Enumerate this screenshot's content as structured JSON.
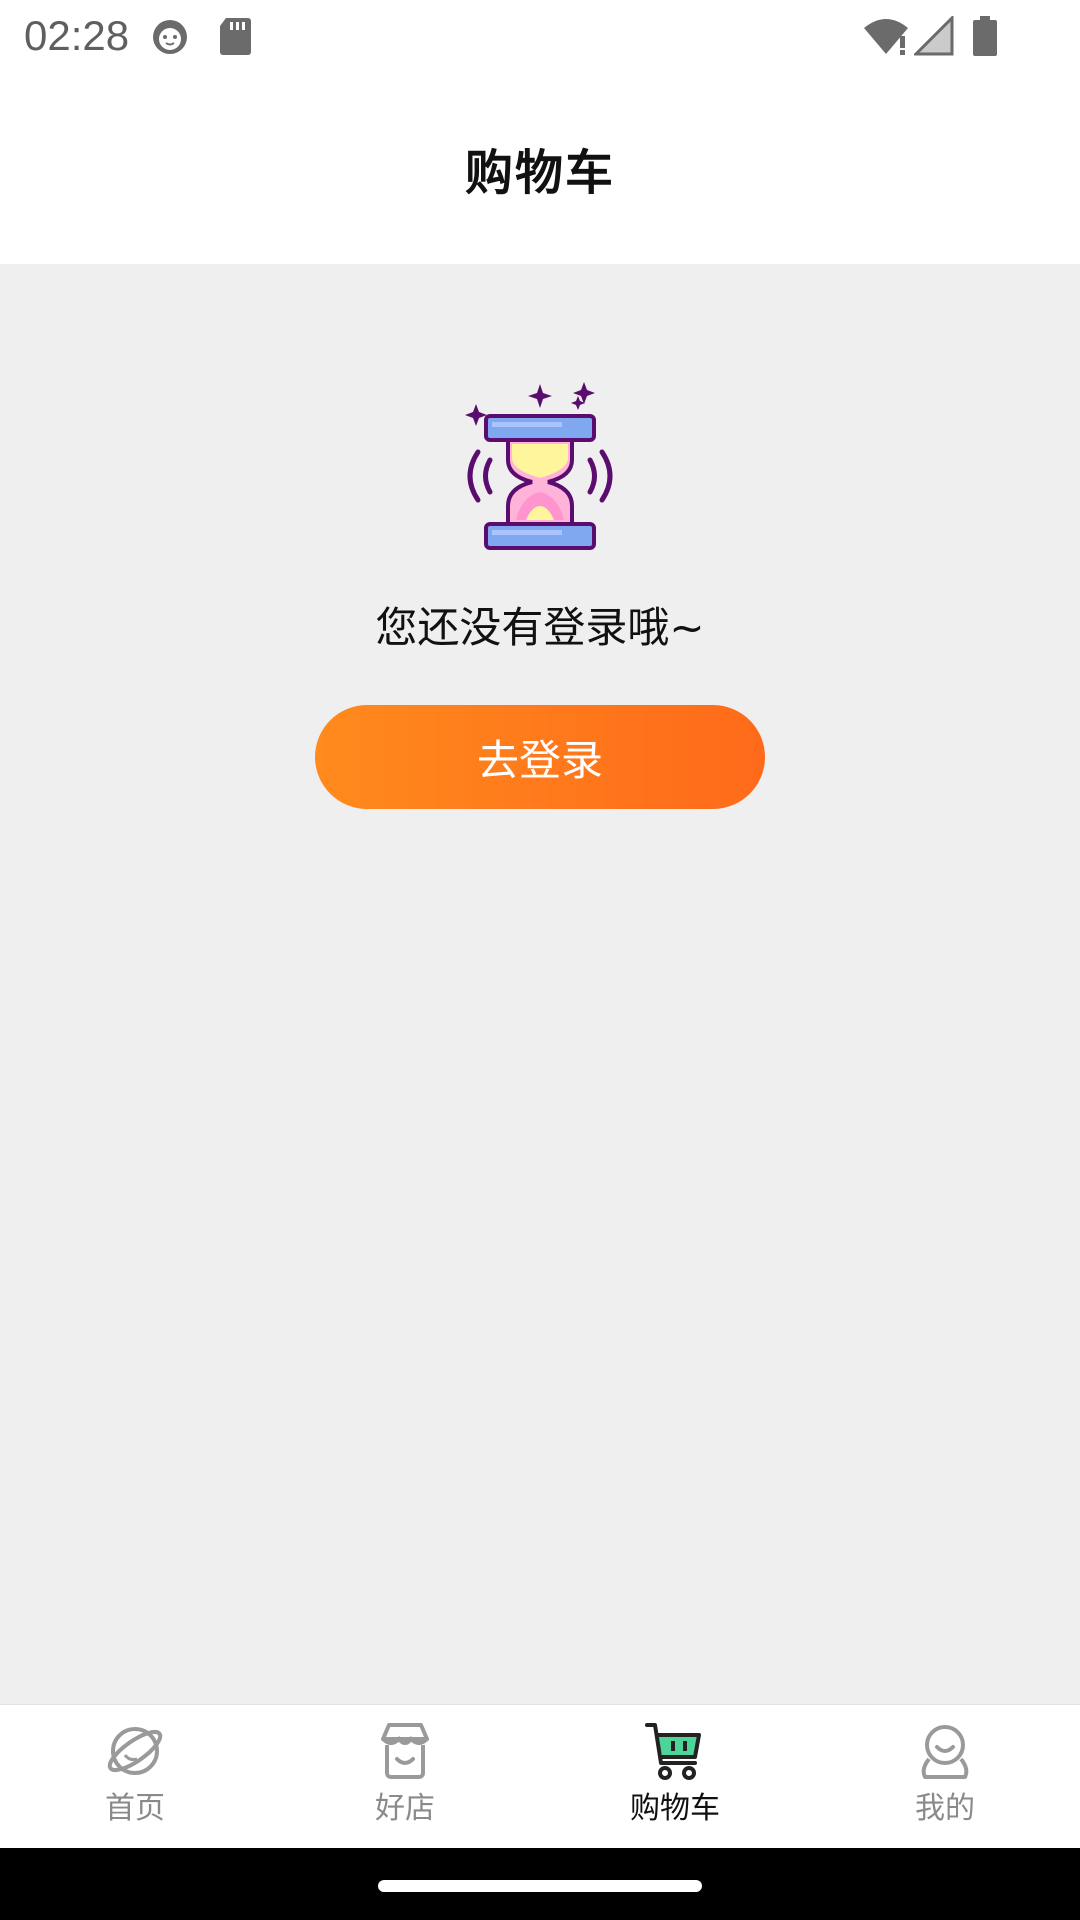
{
  "status_bar": {
    "time": "02:28",
    "icons": [
      "cat-face-icon",
      "sd-card-icon",
      "wifi-alert-icon",
      "cellular-signal-icon",
      "battery-icon"
    ]
  },
  "header": {
    "title": "购物车"
  },
  "empty_state": {
    "illustration": "hourglass-icon",
    "message": "您还没有登录哦~",
    "button_label": "去登录"
  },
  "tab_bar": {
    "tabs": [
      {
        "label": "首页",
        "icon": "planet-icon",
        "active": false
      },
      {
        "label": "好店",
        "icon": "store-icon",
        "active": false
      },
      {
        "label": "购物车",
        "icon": "cart-icon",
        "active": true
      },
      {
        "label": "我的",
        "icon": "user-icon",
        "active": false
      }
    ]
  },
  "colors": {
    "accent_start": "#ff8a1d",
    "accent_end": "#ff6a1a",
    "background": "#efefef",
    "active_tab_icon": "#30c48a"
  }
}
